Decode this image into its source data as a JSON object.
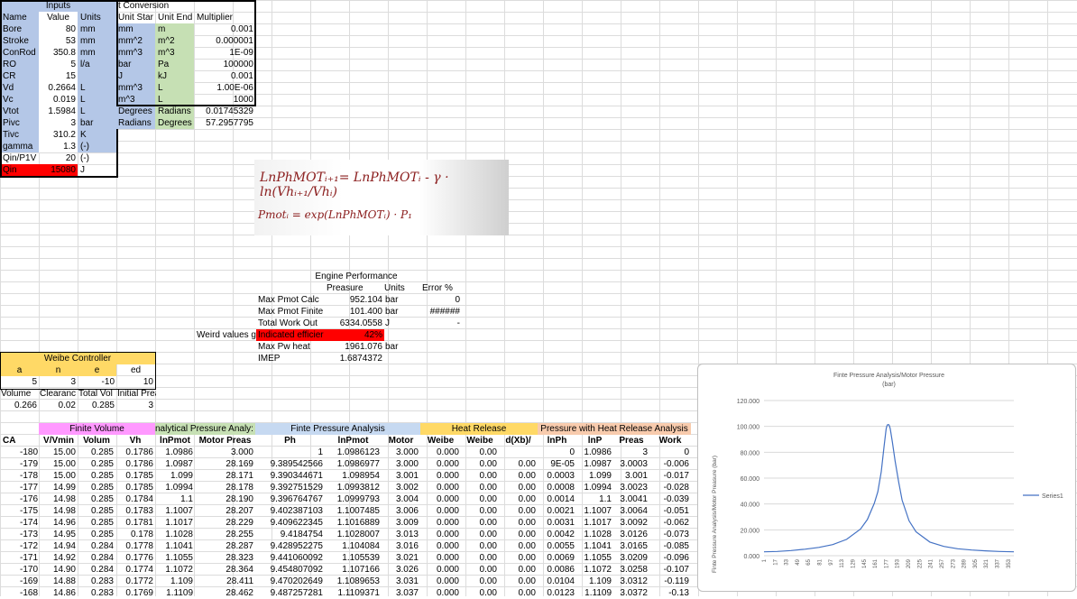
{
  "inputs": {
    "title": "Inputs",
    "headers": [
      "Name",
      "Value",
      "Units"
    ],
    "rows": [
      [
        "Bore",
        "80",
        "mm"
      ],
      [
        "Stroke",
        "53",
        "mm"
      ],
      [
        "ConRod",
        "350.8",
        "mm"
      ],
      [
        "RO",
        "5",
        "l/a"
      ],
      [
        "CR",
        "15",
        ""
      ],
      [
        "Vd",
        "0.2664",
        "L"
      ],
      [
        "Vc",
        "0.019",
        "L"
      ],
      [
        "Vtot",
        "1.5984",
        "L"
      ],
      [
        "Pivc",
        "3",
        "bar"
      ],
      [
        "Tivc",
        "310.2",
        "K"
      ],
      [
        "gamma",
        "1.3",
        "(-)"
      ],
      [
        "Qin/P1V",
        "20",
        "(-)"
      ],
      [
        "Qin",
        "15080",
        "J"
      ]
    ]
  },
  "conversion": {
    "title": "t Conversion",
    "headers": [
      "Unit Star",
      "Unit End",
      "Multiplier"
    ],
    "rows": [
      [
        "mm",
        "m",
        "0.001"
      ],
      [
        "mm^2",
        "m^2",
        "0.000001"
      ],
      [
        "mm^3",
        "m^3",
        "1E-09"
      ],
      [
        "bar",
        "Pa",
        "100000"
      ],
      [
        "J",
        "kJ",
        "0.001"
      ],
      [
        "mm^3",
        "L",
        "1.00E-06"
      ],
      [
        "m^3",
        "L",
        "1000"
      ],
      [
        "Degrees",
        "Radians",
        "0.01745329"
      ],
      [
        "Radians",
        "Degrees",
        "57.2957795"
      ]
    ]
  },
  "equation": {
    "line1": "LnPhMOTᵢ₊₁= LnPhMOTᵢ - γ · ln(Vhᵢ₊₁/Vhᵢ)",
    "line2": "Pmotᵢ = exp(LnPhMOTᵢ) · P₁"
  },
  "performance": {
    "title": "Engine Performance",
    "headers": [
      "Preasure",
      "Units",
      "Error %"
    ],
    "rows": [
      [
        "Max Pmot Calc",
        "952.104",
        "bar",
        "0"
      ],
      [
        "Max Pmot Finite",
        "101.400",
        "bar",
        "######"
      ],
      [
        "Total Work Out",
        "6334.0558",
        "J",
        "-"
      ],
      [
        "Indicated efficier",
        "42%",
        "",
        ""
      ],
      [
        "Max Pw heat",
        "1961.076",
        "bar",
        ""
      ],
      [
        "IMEP",
        "1.6874372",
        "",
        ""
      ]
    ],
    "weird_label": "Weird values g"
  },
  "weibe": {
    "title": "Weibe Controller",
    "headers": [
      "a",
      "n",
      "e",
      "ed"
    ],
    "values": [
      "5",
      "3",
      "-10",
      "10"
    ],
    "headers2": [
      "Volume",
      "Clearanc",
      "Total Vol",
      "Initial Preasure"
    ],
    "values2": [
      "0.266",
      "0.02",
      "0.285",
      "3"
    ]
  },
  "groups": {
    "finite_volume": "Finite Volume",
    "analytical": "nalytical Pressure Analy:",
    "finite_pressure": "Finte Pressure Analysis",
    "heat_release": "Heat Release",
    "pressure_heat": "Pressure with Heat Release Analysis"
  },
  "columns": [
    "CA",
    "V/Vmin",
    "Volum",
    "Vh",
    "lnPmot",
    "Motor Preas",
    "Ph",
    "lnPmot",
    "Motor",
    "Weibe",
    "Weibe",
    "d(Xb)/",
    "lnPh",
    "lnP",
    "Preas",
    "Work"
  ],
  "rows": [
    [
      "-180",
      "15.00",
      "0.285",
      "0.1786",
      "1.0986",
      "3.000",
      "1",
      "1.0986123",
      "3.000",
      "0.000",
      "0.00",
      "",
      "0",
      "1.0986",
      "3",
      "0"
    ],
    [
      "-179",
      "15.00",
      "0.285",
      "0.1786",
      "1.0987",
      "28.169",
      "9.389542566",
      "1.0986977",
      "3.000",
      "0.000",
      "0.00",
      "0.00",
      "9E-05",
      "1.0987",
      "3.0003",
      "-0.006"
    ],
    [
      "-178",
      "15.00",
      "0.285",
      "0.1785",
      "1.099",
      "28.171",
      "9.390344671",
      "1.098954",
      "3.001",
      "0.000",
      "0.00",
      "0.00",
      "0.0003",
      "1.099",
      "3.001",
      "-0.017"
    ],
    [
      "-177",
      "14.99",
      "0.285",
      "0.1785",
      "1.0994",
      "28.178",
      "9.392751529",
      "1.0993812",
      "3.002",
      "0.000",
      "0.00",
      "0.00",
      "0.0008",
      "1.0994",
      "3.0023",
      "-0.028"
    ],
    [
      "-176",
      "14.98",
      "0.285",
      "0.1784",
      "1.1",
      "28.190",
      "9.396764767",
      "1.0999793",
      "3.004",
      "0.000",
      "0.00",
      "0.00",
      "0.0014",
      "1.1",
      "3.0041",
      "-0.039"
    ],
    [
      "-175",
      "14.98",
      "0.285",
      "0.1783",
      "1.1007",
      "28.207",
      "9.402387103",
      "1.1007485",
      "3.006",
      "0.000",
      "0.00",
      "0.00",
      "0.0021",
      "1.1007",
      "3.0064",
      "-0.051"
    ],
    [
      "-174",
      "14.96",
      "0.285",
      "0.1781",
      "1.1017",
      "28.229",
      "9.409622345",
      "1.1016889",
      "3.009",
      "0.000",
      "0.00",
      "0.00",
      "0.0031",
      "1.1017",
      "3.0092",
      "-0.062"
    ],
    [
      "-173",
      "14.95",
      "0.285",
      "0.178",
      "1.1028",
      "28.255",
      "9.4184754",
      "1.1028007",
      "3.013",
      "0.000",
      "0.00",
      "0.00",
      "0.0042",
      "1.1028",
      "3.0126",
      "-0.073"
    ],
    [
      "-172",
      "14.94",
      "0.284",
      "0.1778",
      "1.1041",
      "28.287",
      "9.428952275",
      "1.104084",
      "3.016",
      "0.000",
      "0.00",
      "0.00",
      "0.0055",
      "1.1041",
      "3.0165",
      "-0.085"
    ],
    [
      "-171",
      "14.92",
      "0.284",
      "0.1776",
      "1.1055",
      "28.323",
      "9.441060092",
      "1.105539",
      "3.021",
      "0.000",
      "0.00",
      "0.00",
      "0.0069",
      "1.1055",
      "3.0209",
      "-0.096"
    ],
    [
      "-170",
      "14.90",
      "0.284",
      "0.1774",
      "1.1072",
      "28.364",
      "9.454807092",
      "1.107166",
      "3.026",
      "0.000",
      "0.00",
      "0.00",
      "0.0086",
      "1.1072",
      "3.0258",
      "-0.107"
    ],
    [
      "-169",
      "14.88",
      "0.283",
      "0.1772",
      "1.109",
      "28.411",
      "9.470202649",
      "1.1089653",
      "3.031",
      "0.000",
      "0.00",
      "0.00",
      "0.0104",
      "1.109",
      "3.0312",
      "-0.119"
    ],
    [
      "-168",
      "14.86",
      "0.283",
      "0.1769",
      "1.1109",
      "28.462",
      "9.487257281",
      "1.1109371",
      "3.037",
      "0.000",
      "0.00",
      "0.00",
      "0.0123",
      "1.1109",
      "3.0372",
      "-0.13"
    ]
  ],
  "colors": {
    "inputs": "#b4c7e7",
    "conversion_start": "#b4c7e7",
    "conversion_end": "#c6e0b4",
    "red": "#ff0000",
    "weibe": "#ffd966",
    "finite_volume": "#ff99ff",
    "pressure": "#c6d9f1",
    "heat": "#ffd966",
    "pheat": "#f8cbad"
  },
  "chart_data": {
    "type": "line",
    "title": "Finte Pressure Analysis/Motor Pressure",
    "subtitle": "(bar)",
    "ylabel": "Finte Pressure Analysis/Motor Preasure (bar)",
    "ylim": [
      0,
      120
    ],
    "yticks": [
      "0.000",
      "20.000",
      "40.000",
      "60.000",
      "80.000",
      "100.000",
      "120.000"
    ],
    "xticks": [
      "1",
      "17",
      "33",
      "49",
      "65",
      "81",
      "97",
      "113",
      "129",
      "145",
      "161",
      "177",
      "193",
      "209",
      "225",
      "241",
      "257",
      "273",
      "289",
      "305",
      "321",
      "337",
      "353"
    ],
    "series": [
      {
        "name": "Series1",
        "x": [
          1,
          20,
          40,
          60,
          80,
          100,
          120,
          140,
          150,
          160,
          165,
          170,
          174,
          177,
          178,
          179,
          180,
          181,
          182,
          183,
          186,
          190,
          195,
          200,
          210,
          220,
          240,
          260,
          280,
          300,
          320,
          340,
          361
        ],
        "values": [
          3.0,
          3.3,
          4.0,
          5.0,
          6.4,
          8.6,
          12.6,
          20.6,
          28.0,
          40.5,
          49.5,
          65.0,
          84.5,
          98.0,
          100.3,
          101.3,
          101.4,
          101.2,
          99.8,
          98.0,
          88.0,
          73.0,
          57.0,
          43.0,
          27.0,
          18.5,
          10.5,
          7.2,
          5.4,
          4.4,
          3.8,
          3.3,
          3.0
        ]
      }
    ]
  }
}
